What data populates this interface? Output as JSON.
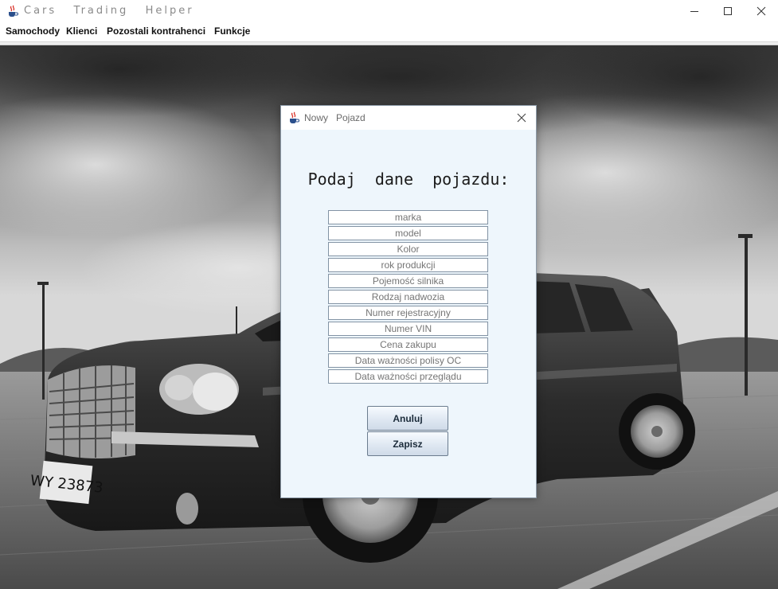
{
  "window": {
    "title": "Cars   Trading   Helper",
    "controls": {
      "minimize": "minimize",
      "maximize": "maximize",
      "close": "close"
    }
  },
  "menubar": {
    "items": [
      {
        "label": "Samochody"
      },
      {
        "label": "Klienci"
      },
      {
        "label": "Pozostali kontrahenci"
      },
      {
        "label": "Funkcje"
      }
    ]
  },
  "dialog": {
    "title": "Nowy   Pojazd",
    "heading": "Podaj  dane  pojazdu:",
    "fields": [
      {
        "placeholder": "marka"
      },
      {
        "placeholder": "model"
      },
      {
        "placeholder": "Kolor"
      },
      {
        "placeholder": "rok produkcji"
      },
      {
        "placeholder": "Pojemość silnika"
      },
      {
        "placeholder": "Rodzaj nadwozia"
      },
      {
        "placeholder": "Numer rejestracyjny"
      },
      {
        "placeholder": "Numer VIN"
      },
      {
        "placeholder": "Cena zakupu"
      },
      {
        "placeholder": "Data ważności polisy OC"
      },
      {
        "placeholder": "Data ważności przeglądu"
      }
    ],
    "buttons": {
      "cancel": "Anuluj",
      "save": "Zapisz"
    }
  },
  "background": {
    "license_plate": "WY 23873"
  },
  "colors": {
    "dialog_bg": "#eef6fc",
    "field_border": "#8293a4",
    "button_border": "#6b7c8e"
  },
  "icons": {
    "app": "java-cup-icon",
    "minimize": "minimize-icon",
    "maximize": "maximize-icon",
    "close": "close-icon"
  }
}
